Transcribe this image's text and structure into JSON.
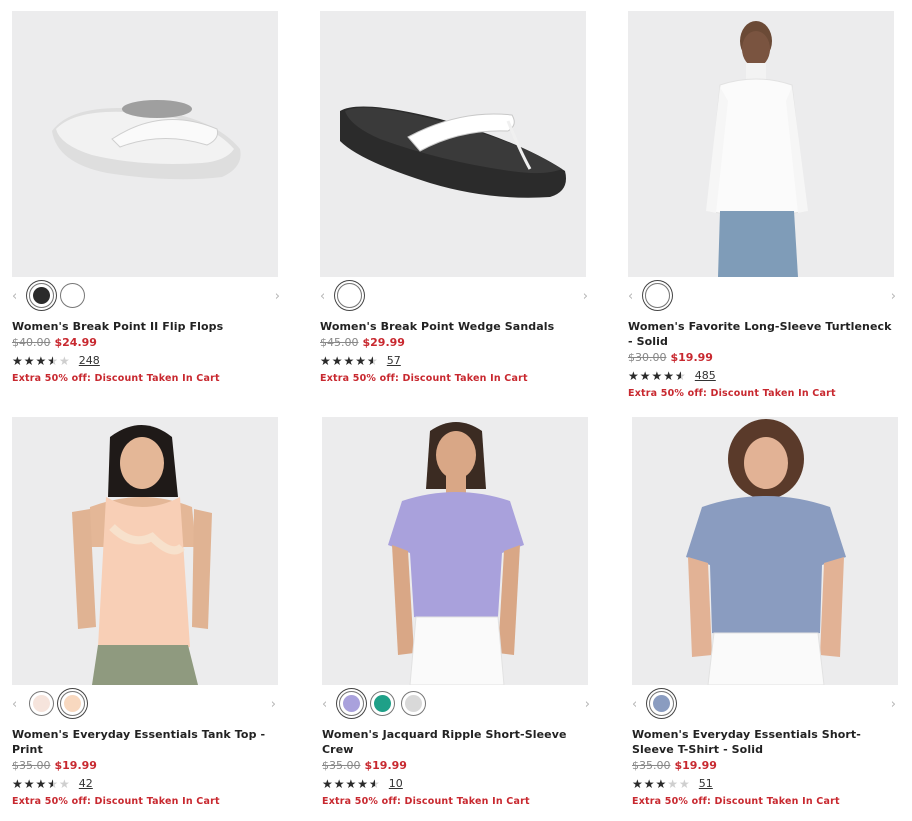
{
  "products": [
    {
      "name": "Women's Break Point II Flip Flops",
      "original_price": "$40.00",
      "sale_price": "$24.99",
      "rating": 3.5,
      "review_count": "248",
      "promo": "Extra 50% off: Discount Taken In Cart",
      "swatches": [
        "#2b2b2b",
        "#ffffff"
      ],
      "selected_swatch": 0
    },
    {
      "name": "Women's Break Point Wedge Sandals",
      "original_price": "$45.00",
      "sale_price": "$29.99",
      "rating": 4.5,
      "review_count": "57",
      "promo": "Extra 50% off: Discount Taken In Cart",
      "swatches": [
        "#ffffff"
      ],
      "selected_swatch": 0
    },
    {
      "name": "Women's Favorite Long-Sleeve Turtleneck - Solid",
      "original_price": "$30.00",
      "sale_price": "$19.99",
      "rating": 4.5,
      "review_count": "485",
      "promo": "Extra 50% off: Discount Taken In Cart",
      "swatches": [
        "#ffffff"
      ],
      "selected_swatch": 0
    },
    {
      "name": "Women's Everyday Essentials Tank Top - Print",
      "original_price": "$35.00",
      "sale_price": "$19.99",
      "rating": 3.5,
      "review_count": "42",
      "promo": "Extra 50% off: Discount Taken In Cart",
      "swatches": [
        "#f6e4dc",
        "#f8d8bf"
      ],
      "selected_swatch": 1
    },
    {
      "name": "Women's Jacquard Ripple Short-Sleeve Crew",
      "original_price": "$35.00",
      "sale_price": "$19.99",
      "rating": 4.5,
      "review_count": "10",
      "promo": "Extra 50% off: Discount Taken In Cart",
      "swatches": [
        "#a9a1dc",
        "#1fa088",
        "#d9d9d9"
      ],
      "selected_swatch": 0
    },
    {
      "name": "Women's Everyday Essentials Short-Sleeve T-Shirt - Solid",
      "original_price": "$35.00",
      "sale_price": "$19.99",
      "rating": 3,
      "review_count": "51",
      "promo": "Extra 50% off: Discount Taken In Cart",
      "swatches": [
        "#8a9cc0"
      ],
      "selected_swatch": 0
    }
  ],
  "icons": {
    "prev": "chevron-left-icon",
    "next": "chevron-right-icon",
    "star": "star-icon"
  },
  "colors": {
    "sale": "#c8282f",
    "image_bg": "#ececed"
  }
}
